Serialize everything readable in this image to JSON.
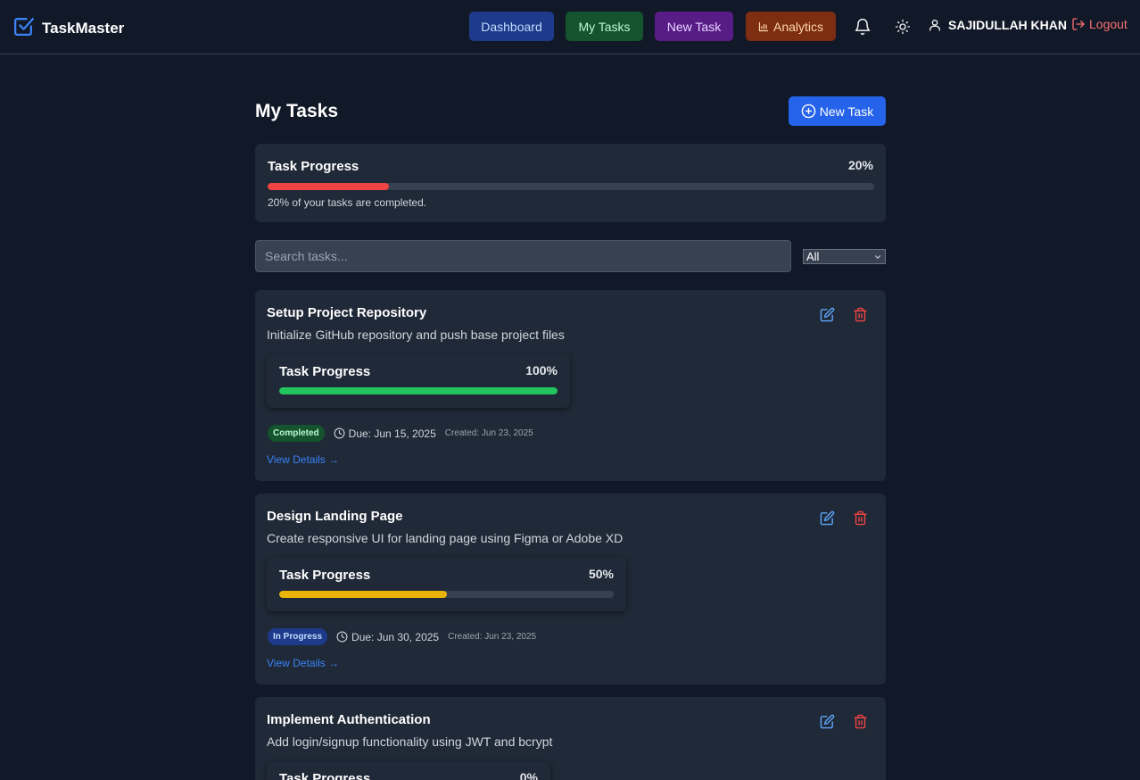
{
  "app": {
    "name": "TaskMaster"
  },
  "nav": {
    "dashboard": "Dashboard",
    "my_tasks": "My Tasks",
    "new_task": "New Task",
    "analytics": "Analytics",
    "user_name": "SAJIDULLAH KHAN",
    "logout": "Logout"
  },
  "page": {
    "title": "My Tasks",
    "new_task_button": "New Task"
  },
  "overall_progress": {
    "title": "Task Progress",
    "percent_label": "20%",
    "percent": 20,
    "caption": "20% of your tasks are completed."
  },
  "filters": {
    "search_placeholder": "Search tasks...",
    "status_selected": "All"
  },
  "tasks": [
    {
      "title": "Setup Project Repository",
      "description": "Initialize GitHub repository and push base project files",
      "progress_title": "Task Progress",
      "progress_label": "100%",
      "progress": 100,
      "bar_color": "#22c55e",
      "status": "Completed",
      "due": "Due: Jun 15, 2025",
      "created": "Created: Jun 23, 2025",
      "link": "View Details →"
    },
    {
      "title": "Design Landing Page",
      "description": "Create responsive UI for landing page using Figma or Adobe XD",
      "progress_title": "Task Progress",
      "progress_label": "50%",
      "progress": 50,
      "bar_color": "#eab308",
      "status": "In Progress",
      "due": "Due: Jun 30, 2025",
      "created": "Created: Jun 23, 2025",
      "link": "View Details →"
    },
    {
      "title": "Implement Authentication",
      "description": "Add login/signup functionality using JWT and bcrypt",
      "progress_title": "Task Progress",
      "progress_label": "0%",
      "progress": 0
    }
  ],
  "colors": {
    "background": "#111827",
    "card": "#1f2937",
    "accent": "#2563eb",
    "overall_bar": "#ef4444"
  }
}
